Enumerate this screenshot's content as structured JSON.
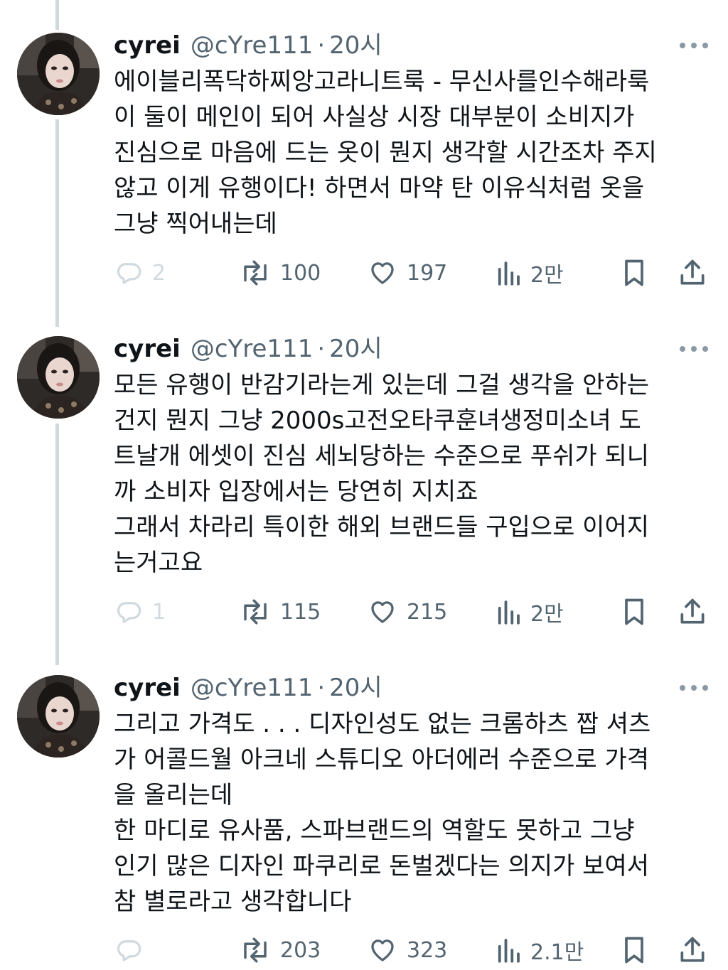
{
  "colors": {
    "text": "#0f1419",
    "secondary": "#536471",
    "thread_line": "#cfd9de",
    "muted_icon": "#cfd9de"
  },
  "tweets": [
    {
      "name": "cyrei",
      "handle": "@cYre111",
      "separator": "·",
      "time": "20시",
      "text": "에이블리폭닥하찌앙고라니트룩 - 무신사를인수해라룩\n이 둘이 메인이 되어 사실상 시장 대부분이 소비지가\n진심으로 마음에 드는 옷이 뭔지 생각할 시간조차 주지\n않고 이게 유행이다! 하면서 마약 탄 이유식처럼 옷을\n그냥 찍어내는데",
      "replies": "2",
      "retweets": "100",
      "likes": "197",
      "views": "2만"
    },
    {
      "name": "cyrei",
      "handle": "@cYre111",
      "separator": "·",
      "time": "20시",
      "text": "모든 유행이 반감기라는게 있는데 그걸 생각을 안하는\n건지 뭔지 그냥 2000s고전오타쿠훈녀생정미소녀 도\n트날개 에셋이 진심 세뇌당하는 수준으로 푸쉬가 되니\n까 소비자 입장에서는 당연히 지치죠\n그래서 차라리 특이한 해외 브랜드들 구입으로 이어지\n는거고요",
      "replies": "1",
      "retweets": "115",
      "likes": "215",
      "views": "2만"
    },
    {
      "name": "cyrei",
      "handle": "@cYre111",
      "separator": "·",
      "time": "20시",
      "text": "그리고 가격도 . . . 디자인성도 없는 크롬하츠 짭 셔츠\n가 어콜드월 아크네 스튜디오 아더에러 수준으로 가격\n을 올리는데\n한 마디로 유사품, 스파브랜드의 역할도 못하고 그냥\n인기 많은 디자인 파쿠리로 돈벌겠다는 의지가 보여서\n참 별로라고 생각합니다",
      "replies": "",
      "retweets": "203",
      "likes": "323",
      "views": "2.1만"
    }
  ]
}
